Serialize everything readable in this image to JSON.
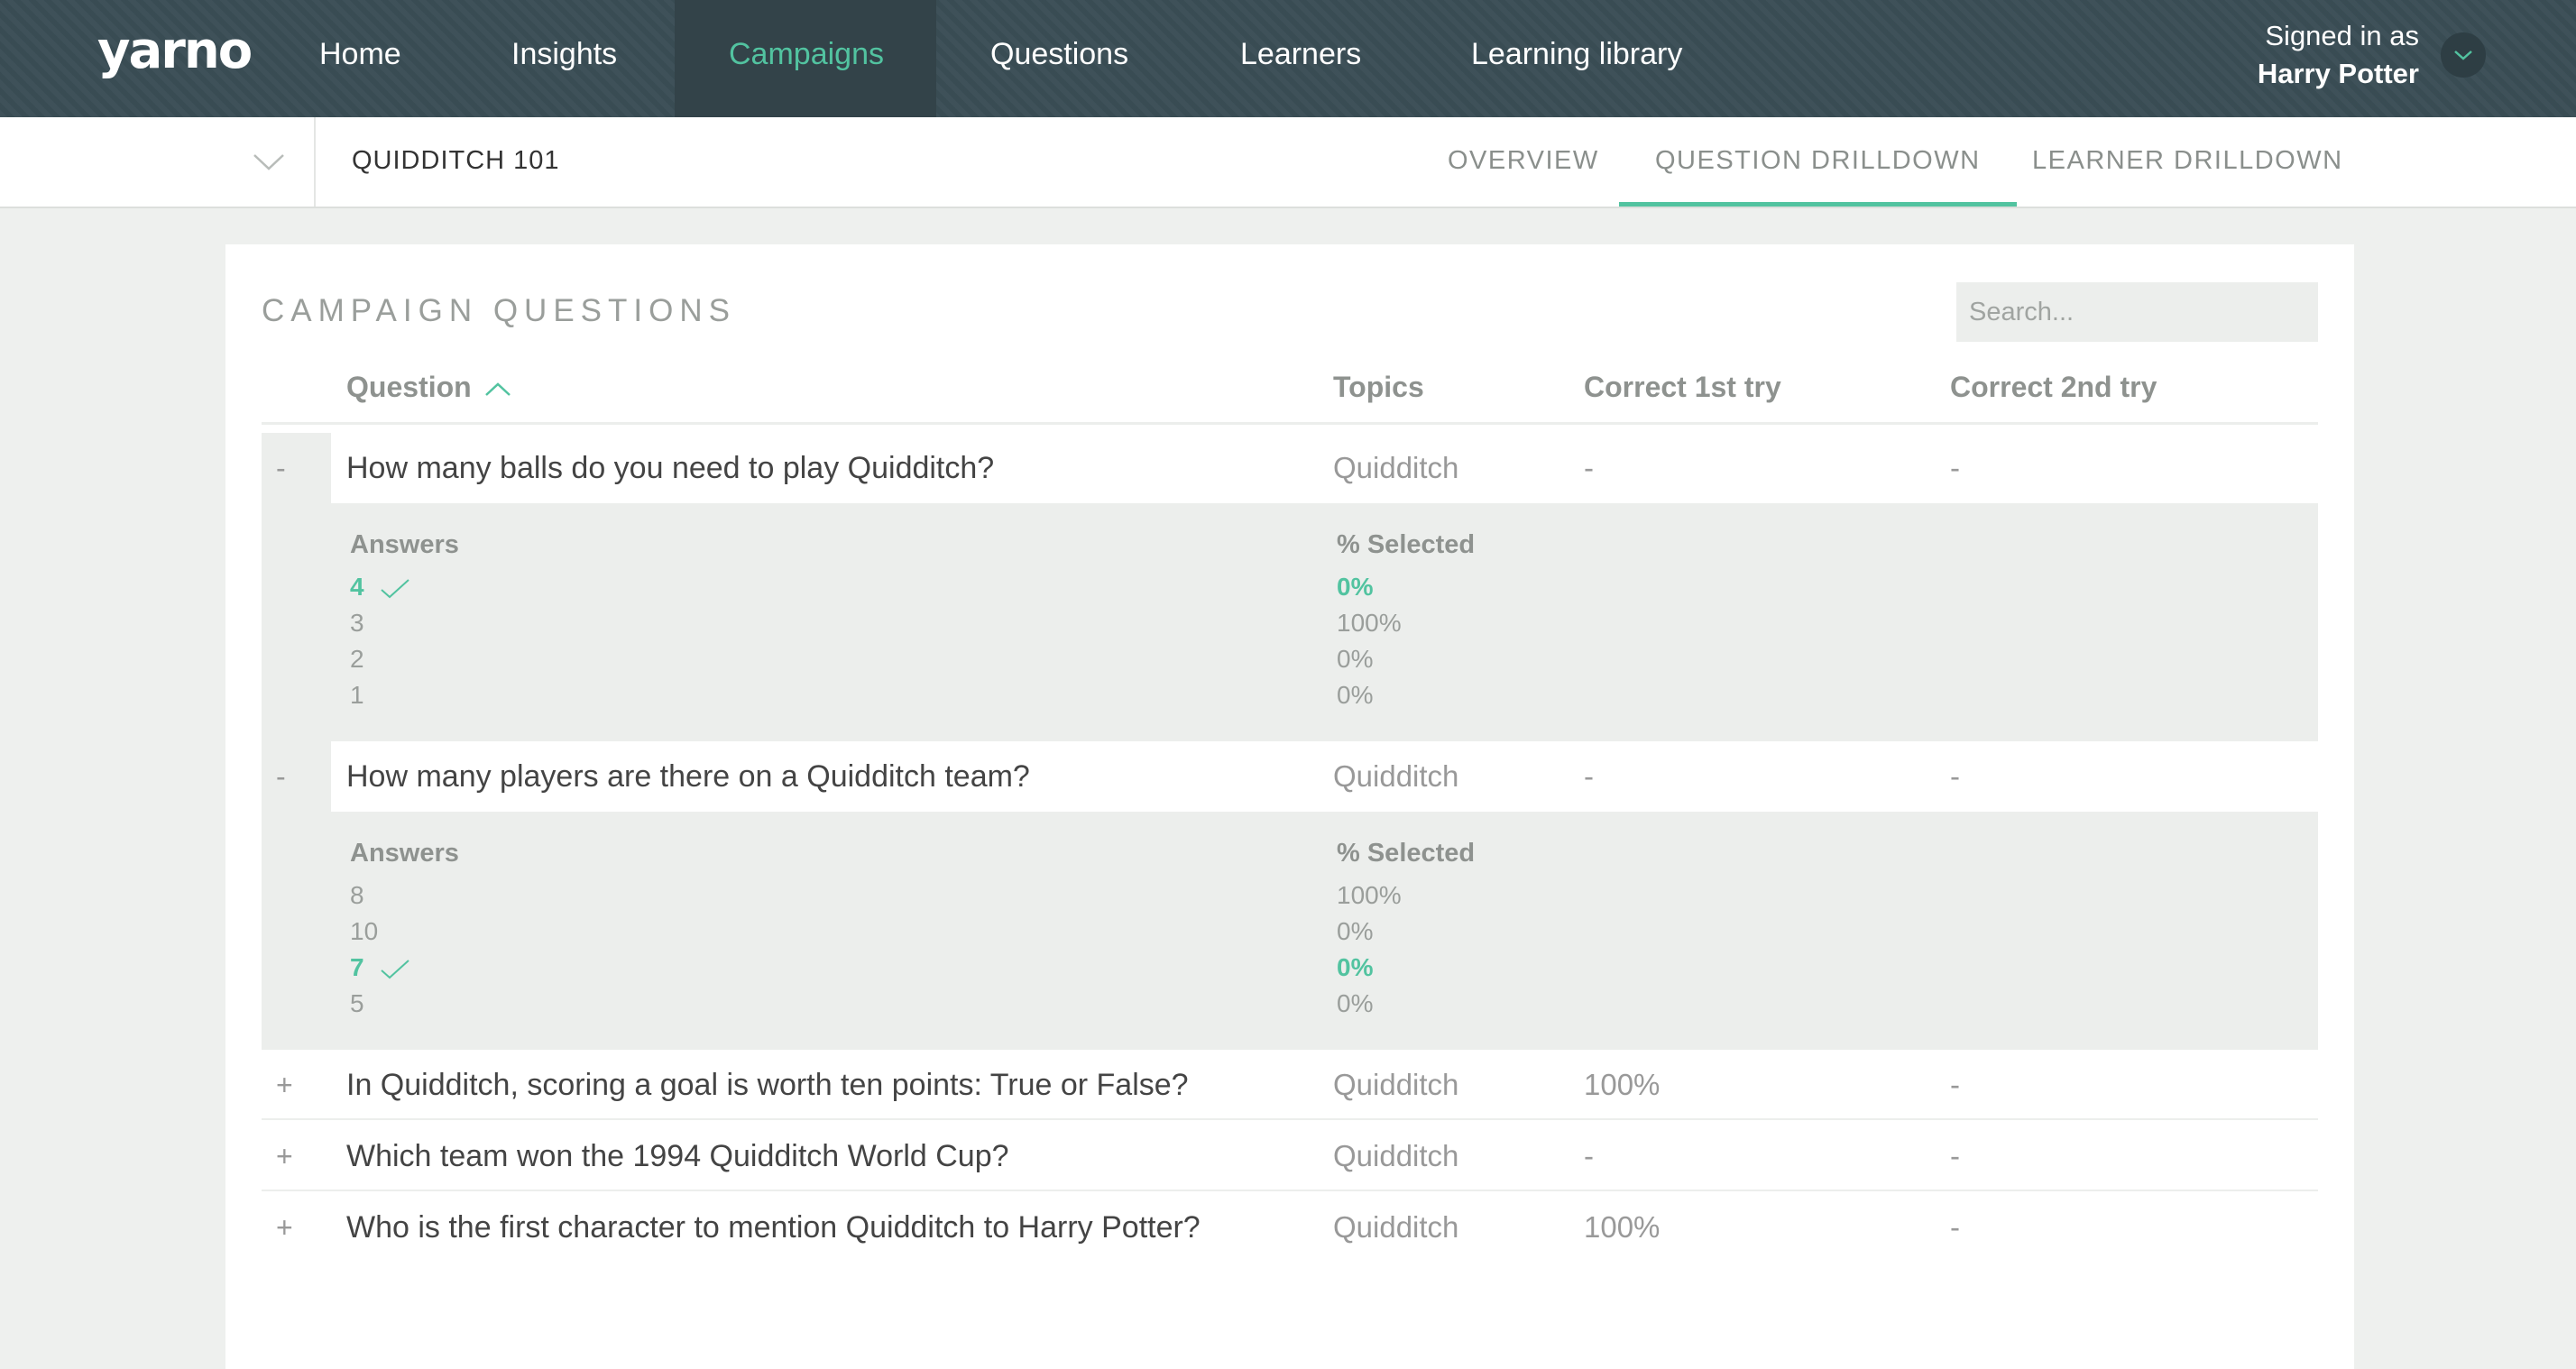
{
  "nav": {
    "logo": "yarno",
    "items": [
      {
        "label": "Home"
      },
      {
        "label": "Insights"
      },
      {
        "label": "Campaigns"
      },
      {
        "label": "Questions"
      },
      {
        "label": "Learners"
      },
      {
        "label": "Learning library"
      }
    ],
    "active": "Campaigns",
    "signed_in_label": "Signed in as",
    "user_name": "Harry Potter"
  },
  "subbar": {
    "campaign_name": "QUIDDITCH 101",
    "tabs": [
      {
        "label": "OVERVIEW"
      },
      {
        "label": "QUESTION DRILLDOWN"
      },
      {
        "label": "LEARNER DRILLDOWN"
      }
    ],
    "active_tab": "QUESTION DRILLDOWN"
  },
  "panel": {
    "title": "CAMPAIGN QUESTIONS",
    "search_placeholder": "Search...",
    "columns": {
      "question": "Question",
      "topics": "Topics",
      "correct_1st": "Correct 1st try",
      "correct_2nd": "Correct 2nd try"
    },
    "sort": "question-ascending",
    "questions": [
      {
        "toggle": "-",
        "question": "How many balls do you need to play Quidditch?",
        "topic": "Quidditch",
        "correct_1st": "-",
        "correct_2nd": "-",
        "answers_label": "Answers",
        "selected_label": "% Selected",
        "answers": [
          {
            "answer": "4",
            "selected": "0%",
            "correct": true
          },
          {
            "answer": "3",
            "selected": "100%",
            "correct": false
          },
          {
            "answer": "2",
            "selected": "0%",
            "correct": false
          },
          {
            "answer": "1",
            "selected": "0%",
            "correct": false
          }
        ]
      },
      {
        "toggle": "-",
        "question": "How many players are there on a Quidditch team?",
        "topic": "Quidditch",
        "correct_1st": "-",
        "correct_2nd": "-",
        "answers_label": "Answers",
        "selected_label": "% Selected",
        "answers": [
          {
            "answer": "8",
            "selected": "100%",
            "correct": false
          },
          {
            "answer": "10",
            "selected": "0%",
            "correct": false
          },
          {
            "answer": "7",
            "selected": "0%",
            "correct": true
          },
          {
            "answer": "5",
            "selected": "0%",
            "correct": false
          }
        ]
      },
      {
        "toggle": "+",
        "question": "In Quidditch, scoring a goal is worth ten points: True or False?",
        "topic": "Quidditch",
        "correct_1st": "100%",
        "correct_2nd": "-"
      },
      {
        "toggle": "+",
        "question": "Which team won the 1994 Quidditch World Cup?",
        "topic": "Quidditch",
        "correct_1st": "-",
        "correct_2nd": "-"
      },
      {
        "toggle": "+",
        "question": "Who is the first character to mention Quidditch to Harry Potter?",
        "topic": "Quidditch",
        "correct_1st": "100%",
        "correct_2nd": "-"
      }
    ]
  },
  "colors": {
    "nav_bg": "#3a4d55",
    "accent": "#52c3a0",
    "page_bg": "#eef0ee"
  }
}
